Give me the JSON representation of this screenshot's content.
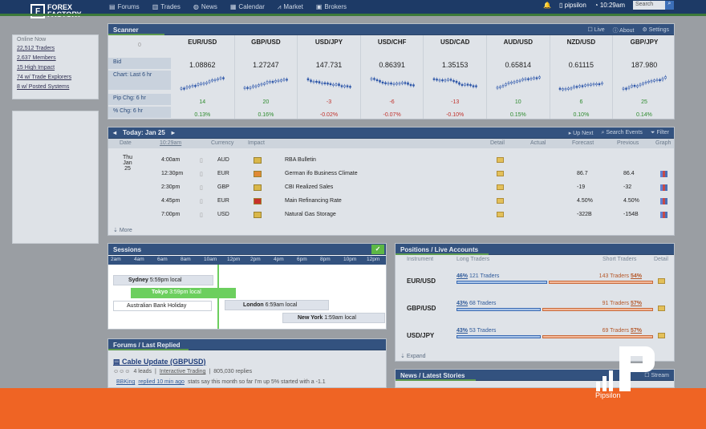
{
  "nav": {
    "logo_line1": "FOREX",
    "logo_line2": "FACTORY",
    "items": [
      "Forums",
      "Trades",
      "News",
      "Calendar",
      "Market",
      "Brokers"
    ],
    "user": "pipsilon",
    "time": "10:29am",
    "search_placeholder": "Search"
  },
  "online": {
    "title": "Online Now",
    "links": [
      "22,512 Traders",
      "2,637 Members",
      "15 High Impact",
      "74 w/ Trade Explorers",
      "8 w/ Posted Systems"
    ]
  },
  "scanner": {
    "title": "Scanner",
    "live": "Live",
    "about": "About",
    "settings": "Settings",
    "zero": "0",
    "row_labels": [
      "Bid",
      "Chart: Last 6 hr",
      "Pip Chg: 6 hr",
      "% Chg: 6 hr"
    ],
    "pairs": [
      {
        "name": "EUR/USD",
        "bid": "1.08862",
        "pip": "14",
        "pct": "0.13%",
        "dir": "up"
      },
      {
        "name": "GBP/USD",
        "bid": "1.27247",
        "pip": "20",
        "pct": "0.16%",
        "dir": "up"
      },
      {
        "name": "USD/JPY",
        "bid": "147.731",
        "pip": "-3",
        "pct": "-0.02%",
        "dir": "down"
      },
      {
        "name": "USD/CHF",
        "bid": "0.86391",
        "pip": "-6",
        "pct": "-0.07%",
        "dir": "down"
      },
      {
        "name": "USD/CAD",
        "bid": "1.35153",
        "pip": "-13",
        "pct": "-0.10%",
        "dir": "down"
      },
      {
        "name": "AUD/USD",
        "bid": "0.65814",
        "pip": "10",
        "pct": "0.15%",
        "dir": "up"
      },
      {
        "name": "NZD/USD",
        "bid": "0.61115",
        "pip": "6",
        "pct": "0.10%",
        "dir": "up"
      },
      {
        "name": "GBP/JPY",
        "bid": "187.980",
        "pip": "25",
        "pct": "0.14%",
        "dir": "up"
      }
    ],
    "colors": {
      "up": "#2e8b2e",
      "down": "#c0312b"
    }
  },
  "calendar": {
    "today": "Today: Jan 25",
    "up_next": "Up Next",
    "search": "Search Events",
    "filter": "Filter",
    "headers": [
      "Date",
      "10:29am",
      "Currency",
      "Impact",
      "Detail",
      "Actual",
      "Forecast",
      "Previous",
      "Graph"
    ],
    "date_day": "Thu",
    "date_num": "Jan 25",
    "events": [
      {
        "time": "4:00am",
        "cur": "AUD",
        "name": "RBA Bulletin",
        "forecast": "",
        "previous": "",
        "impact": "#d9b74a"
      },
      {
        "time": "12:30pm",
        "cur": "EUR",
        "name": "German ifo Business Climate",
        "forecast": "86.7",
        "previous": "86.4",
        "impact": "#e08a35"
      },
      {
        "time": "2:30pm",
        "cur": "GBP",
        "name": "CBI Realized Sales",
        "forecast": "-19",
        "previous": "-32",
        "impact": "#d9b74a"
      },
      {
        "time": "4:45pm",
        "cur": "EUR",
        "name": "Main Refinancing Rate",
        "forecast": "4.50%",
        "previous": "4.50%",
        "impact": "#c8302b"
      },
      {
        "time": "7:00pm",
        "cur": "USD",
        "name": "Natural Gas Storage",
        "forecast": "-322B",
        "previous": "-154B",
        "impact": "#d9b74a"
      }
    ],
    "more": "More"
  },
  "sessions": {
    "title": "Sessions",
    "hours": [
      "2am",
      "4am",
      "6am",
      "8am",
      "10am",
      "12pm",
      "2pm",
      "4pm",
      "6pm",
      "8pm",
      "10pm",
      "12pm"
    ],
    "sydney_name": "Sydney",
    "sydney_time": "5:59pm local",
    "tokyo_name": "Tokyo",
    "tokyo_time": "3:59pm local",
    "holiday": "Australian Bank Holiday",
    "london_name": "London",
    "london_time": "6:59am local",
    "ny_name": "New York",
    "ny_time": "1:59am local"
  },
  "positions": {
    "title": "Positions / Live Accounts",
    "headers": [
      "Instrument",
      "Long Traders",
      "Short Traders",
      "Detail"
    ],
    "rows": [
      {
        "pair": "EUR/USD",
        "long_pct": "46%",
        "long_cnt": "121 Traders",
        "short_cnt": "143 Traders",
        "short_pct": "54%",
        "long_frac": 0.46
      },
      {
        "pair": "GBP/USD",
        "long_pct": "43%",
        "long_cnt": "68 Traders",
        "short_cnt": "91 Traders",
        "short_pct": "57%",
        "long_frac": 0.43
      },
      {
        "pair": "USD/JPY",
        "long_pct": "43%",
        "long_cnt": "53 Traders",
        "short_cnt": "69 Traders",
        "short_pct": "57%",
        "long_frac": 0.43
      }
    ],
    "expand": "Expand"
  },
  "forums": {
    "title": "Forums / Last Replied",
    "thread": "Cable Update (GBPUSD)",
    "leads": "4 leads",
    "category": "Interactive Trading",
    "replies": "805,030 replies",
    "last_user": "BBKing",
    "last_time": "replied 10 min ago",
    "excerpt": "stats say this month so far I'm up 5% started with a -1.1"
  },
  "news": {
    "title": "News / Latest Stories",
    "stream": "Stream"
  },
  "watermark": "Pipsilon"
}
